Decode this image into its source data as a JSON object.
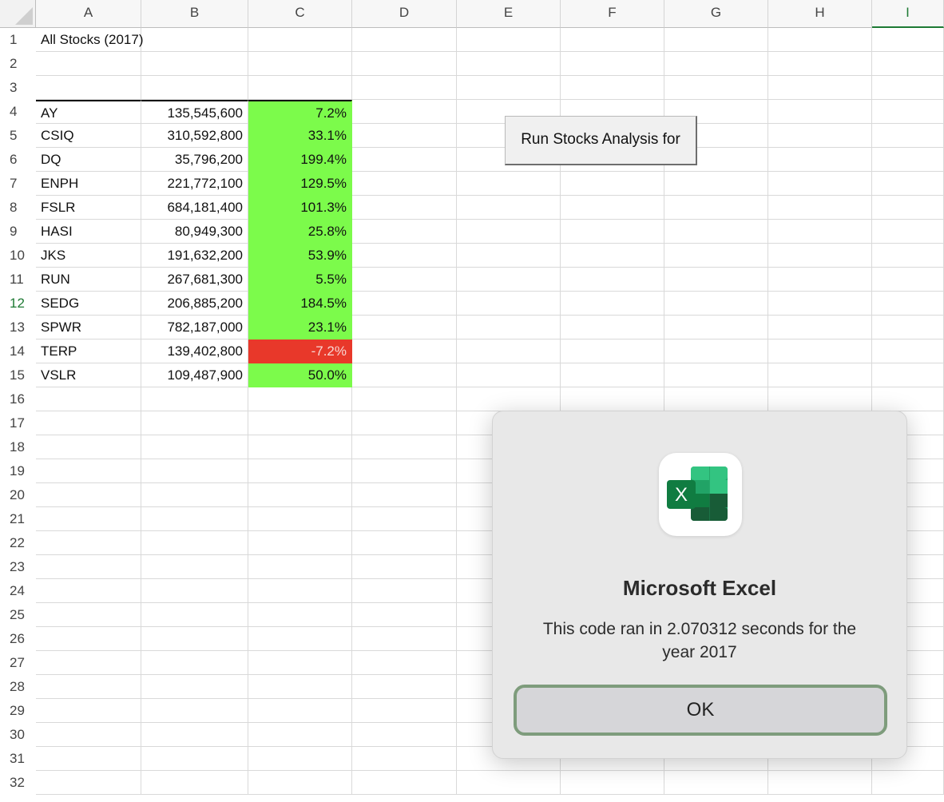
{
  "sheet": {
    "columns": [
      "A",
      "B",
      "C",
      "D",
      "E",
      "F",
      "G",
      "H",
      "I"
    ],
    "selected_column": "I",
    "selected_row": "12",
    "rows": [
      "1",
      "2",
      "3",
      "4",
      "5",
      "6",
      "7",
      "8",
      "9",
      "10",
      "11",
      "12",
      "13",
      "14",
      "15",
      "16",
      "17",
      "18",
      "19",
      "20",
      "21",
      "22",
      "23",
      "24",
      "25",
      "26",
      "27",
      "28",
      "29",
      "30",
      "31",
      "32"
    ],
    "title_cell": "All Stocks (2017)",
    "data": [
      {
        "ticker": "AY",
        "volume": "135,545,600",
        "return": "7.2%",
        "positive": true
      },
      {
        "ticker": "CSIQ",
        "volume": "310,592,800",
        "return": "33.1%",
        "positive": true
      },
      {
        "ticker": "DQ",
        "volume": "35,796,200",
        "return": "199.4%",
        "positive": true
      },
      {
        "ticker": "ENPH",
        "volume": "221,772,100",
        "return": "129.5%",
        "positive": true
      },
      {
        "ticker": "FSLR",
        "volume": "684,181,400",
        "return": "101.3%",
        "positive": true
      },
      {
        "ticker": "HASI",
        "volume": "80,949,300",
        "return": "25.8%",
        "positive": true
      },
      {
        "ticker": "JKS",
        "volume": "191,632,200",
        "return": "53.9%",
        "positive": true
      },
      {
        "ticker": "RUN",
        "volume": "267,681,300",
        "return": "5.5%",
        "positive": true
      },
      {
        "ticker": "SEDG",
        "volume": "206,885,200",
        "return": "184.5%",
        "positive": true
      },
      {
        "ticker": "SPWR",
        "volume": "782,187,000",
        "return": "23.1%",
        "positive": true
      },
      {
        "ticker": "TERP",
        "volume": "139,402,800",
        "return": "-7.2%",
        "positive": false
      },
      {
        "ticker": "VSLR",
        "volume": "109,487,900",
        "return": "50.0%",
        "positive": true
      }
    ],
    "colors": {
      "positive_fill": "#7cfb4b",
      "negative_fill": "#e8382a",
      "selection_green": "#1e7a34"
    }
  },
  "run_button": {
    "label": "Run Stocks Analysis for"
  },
  "dialog": {
    "app_icon": "excel-app-icon",
    "icon_letter": "X",
    "title": "Microsoft Excel",
    "message": "This code ran in 2.070312 seconds for the year 2017",
    "ok_label": "OK"
  }
}
